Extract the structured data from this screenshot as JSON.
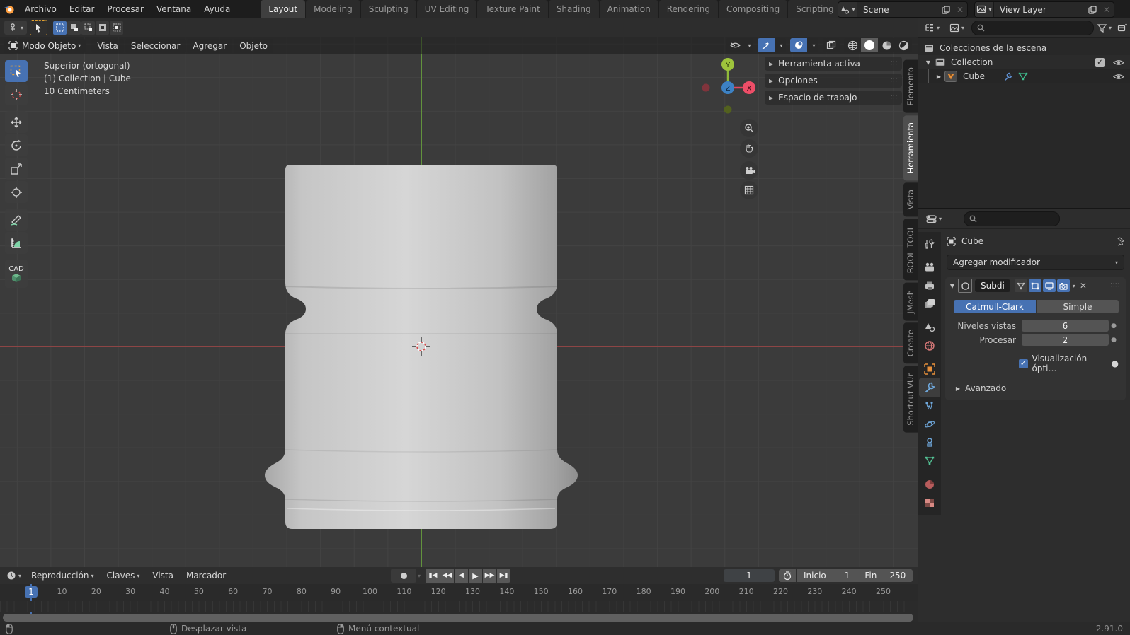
{
  "topbar": {
    "menus": [
      "Archivo",
      "Editar",
      "Procesar",
      "Ventana",
      "Ayuda"
    ],
    "workspaces": [
      {
        "label": "Layout",
        "active": true
      },
      {
        "label": "Modeling"
      },
      {
        "label": "Sculpting"
      },
      {
        "label": "UV Editing"
      },
      {
        "label": "Texture Paint"
      },
      {
        "label": "Shading"
      },
      {
        "label": "Animation"
      },
      {
        "label": "Rendering"
      },
      {
        "label": "Compositing"
      },
      {
        "label": "Scripting"
      },
      {
        "label": "+",
        "plus": true
      }
    ],
    "scene": {
      "label": "Scene"
    },
    "view_layer": {
      "label": "View Layer"
    }
  },
  "toolsettings": {
    "orientation": "Global",
    "options_label": "Opciones"
  },
  "viewport": {
    "header": {
      "mode": "Modo Objeto",
      "menus": [
        "Vista",
        "Seleccionar",
        "Agregar",
        "Objeto"
      ]
    },
    "overlay_text": {
      "line1": "Superior (ortogonal)",
      "line2": "(1) Collection | Cube",
      "line3": "10 Centimeters"
    },
    "side_panels": [
      "Herramienta activa",
      "Opciones",
      "Espacio de trabajo"
    ],
    "sidebar_tabs": [
      {
        "label": "Elemento"
      },
      {
        "label": "Herramienta",
        "active": true
      },
      {
        "label": "Vista"
      },
      {
        "label": "BOOL TOOL"
      },
      {
        "label": "JMesh"
      },
      {
        "label": "Create"
      },
      {
        "label": "Shortcut VUr"
      }
    ],
    "gizmo": {
      "x": "X",
      "y": "Y",
      "z": "Z"
    }
  },
  "toolbar": {
    "tools": [
      {
        "name": "select-box",
        "active": true
      },
      {
        "name": "cursor"
      },
      {
        "gap": true
      },
      {
        "name": "move"
      },
      {
        "name": "rotate"
      },
      {
        "name": "scale"
      },
      {
        "name": "transform"
      },
      {
        "gap": true
      },
      {
        "name": "annotate"
      },
      {
        "name": "measure"
      },
      {
        "gap": true
      },
      {
        "name": "cad",
        "label": "CAD"
      }
    ]
  },
  "outliner": {
    "rows": {
      "scene_collection": "Colecciones de la escena",
      "collection": "Collection",
      "object": "Cube"
    }
  },
  "properties": {
    "breadcrumb": "Cube",
    "add_modifier_label": "Agregar modificador",
    "tabs": [
      {
        "name": "tool"
      },
      {
        "gap": true
      },
      {
        "name": "render"
      },
      {
        "name": "output"
      },
      {
        "name": "view-layer"
      },
      {
        "gap": true
      },
      {
        "name": "scene"
      },
      {
        "name": "world"
      },
      {
        "gap": true
      },
      {
        "name": "object"
      },
      {
        "name": "modifiers",
        "active": true
      },
      {
        "name": "particles"
      },
      {
        "name": "physics"
      },
      {
        "name": "constraints"
      },
      {
        "name": "data"
      },
      {
        "gap": true
      },
      {
        "name": "material"
      },
      {
        "name": "texture"
      }
    ],
    "modifier": {
      "name": "Subdi",
      "algorithm_selected": "Catmull-Clark",
      "algorithm_other": "Simple",
      "fields": {
        "levels_label": "Niveles vistas",
        "levels_value": "6",
        "render_label": "Procesar",
        "render_value": "2"
      },
      "checkbox_label": "Visualización ópti…",
      "advanced_label": "Avanzado"
    }
  },
  "timeline": {
    "menus": [
      {
        "label": "Reproducción",
        "chev": true
      },
      {
        "label": "Claves",
        "chev": true
      },
      {
        "label": "Vista"
      },
      {
        "label": "Marcador"
      }
    ],
    "current_frame": "1",
    "start_label": "Inicio",
    "start_value": "1",
    "end_label": "Fin",
    "end_value": "250",
    "ticks": [
      10,
      20,
      30,
      40,
      50,
      60,
      70,
      80,
      90,
      100,
      110,
      120,
      130,
      140,
      150,
      160,
      170,
      180,
      190,
      200,
      210,
      220,
      230,
      240,
      250
    ]
  },
  "statusbar": {
    "hints": [
      {
        "icon": "mouse-left",
        "label": ""
      },
      {
        "icon": "mouse-middle",
        "label": "Desplazar vista"
      },
      {
        "icon": "mouse-right",
        "label": "Menú contextual"
      }
    ],
    "version": "2.91.0"
  },
  "colors": {
    "accent": "#4772b3",
    "axis_x": "#a04646",
    "axis_y": "#67a03c",
    "object_orange": "#e8903a"
  }
}
